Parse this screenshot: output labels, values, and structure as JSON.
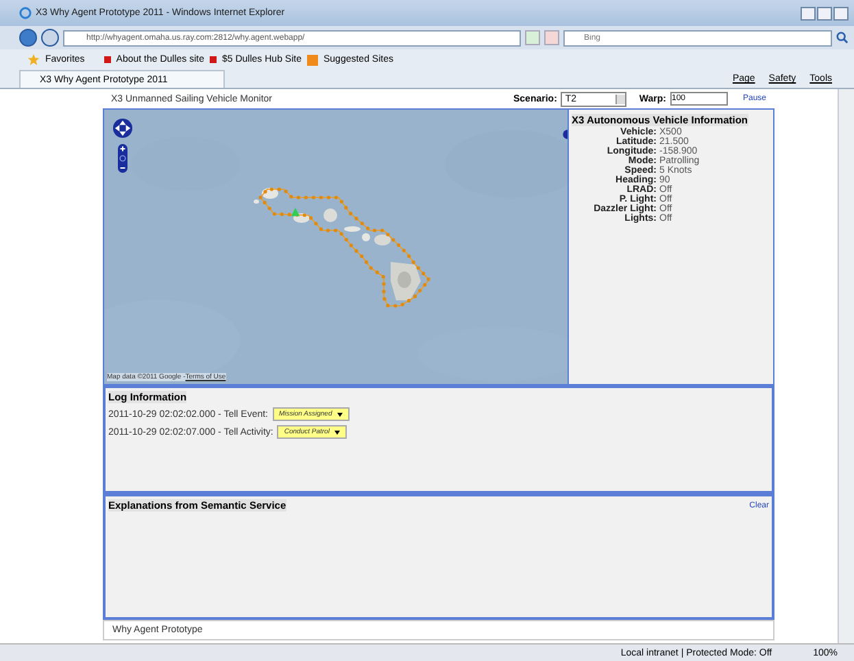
{
  "window": {
    "title": "X3 Why Agent Prototype 2011 - Windows Internet Explorer"
  },
  "address_bar": {
    "url": "http://whyagent.omaha.us.ray.com:2812/why.agent.webapp/"
  },
  "search": {
    "placeholder": "Bing"
  },
  "favorites_bar": {
    "favorites": "Favorites",
    "links": [
      "About the Dulles site",
      "$5 Dulles Hub Site",
      "Suggested Sites"
    ]
  },
  "tabs": [
    {
      "label": "X3 Why Agent Prototype 2011",
      "selected": true
    }
  ],
  "command_bar": [
    "Page",
    "Safety",
    "Tools"
  ],
  "app": {
    "title": "X3 Unmanned Sailing Vehicle Monitor",
    "scenario_label": "Scenario:",
    "scenario": "T2",
    "warp_label": "Warp:",
    "warp": "100",
    "pause": "Pause"
  },
  "map": {
    "attribution": "Map data ©2011 Google - ",
    "terms": "Terms of Use"
  },
  "vehicle_info": {
    "title": "X3 Autonomous Vehicle Information",
    "fields": [
      {
        "label": "Vehicle:",
        "value": "X500"
      },
      {
        "label": "Latitude:",
        "value": "21.500"
      },
      {
        "label": "Longitude:",
        "value": "-158.900"
      },
      {
        "label": "Mode:",
        "value": "Patrolling"
      },
      {
        "label": "Speed:",
        "value": "5 Knots"
      },
      {
        "label": "Heading:",
        "value": "90"
      },
      {
        "label": "LRAD:",
        "value": "Off"
      },
      {
        "label": "P. Light:",
        "value": "Off"
      },
      {
        "label": "Dazzler Light:",
        "value": "Off"
      },
      {
        "label": "Lights:",
        "value": "Off"
      }
    ]
  },
  "log": {
    "title": "Log Information",
    "entries": [
      {
        "text": "2011-10-29 02:02:02.000 - Tell Event:",
        "tag": "Mission Assigned"
      },
      {
        "text": "2011-10-29 02:02:07.000 - Tell Activity:",
        "tag": "Conduct Patrol"
      }
    ]
  },
  "explanations": {
    "title": "Explanations from Semantic Service",
    "clear": "Clear"
  },
  "footer": "Why Agent Prototype",
  "status_bar": {
    "zone": "Local intranet | Protected Mode: Off",
    "zoom": "100%"
  }
}
